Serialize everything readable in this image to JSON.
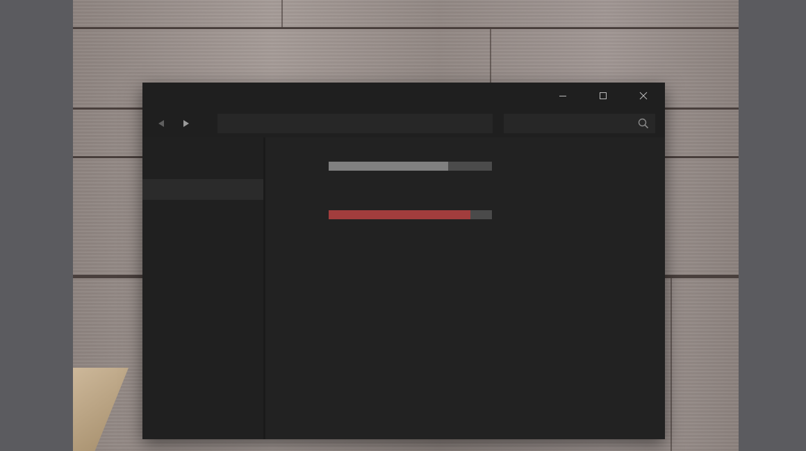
{
  "colors": {
    "window_bg": "#1f1f1f",
    "content_bg": "#222222",
    "sidebar_selected": "#2b2b2b",
    "bar1_fill": "#808080",
    "bar2_fill": "#a23d3d",
    "icon": "#9a9a9a",
    "icon_dim": "#5f5f5f"
  },
  "titlebar": {
    "icons": [
      "minimize-icon",
      "maximize-icon",
      "close-icon"
    ]
  },
  "navbar": {
    "back_icon": "chevron-left-icon",
    "forward_icon": "chevron-right-icon",
    "address": {
      "value": "",
      "placeholder": ""
    },
    "search": {
      "value": "",
      "placeholder": "",
      "icon": "search-icon"
    }
  },
  "sidebar": {
    "items": [
      {
        "label": "",
        "selected": false
      },
      {
        "label": "",
        "selected": true
      }
    ]
  },
  "content": {
    "bars": [
      {
        "label": "",
        "fraction": 0.73
      },
      {
        "label": "",
        "fraction": 0.87
      }
    ]
  }
}
